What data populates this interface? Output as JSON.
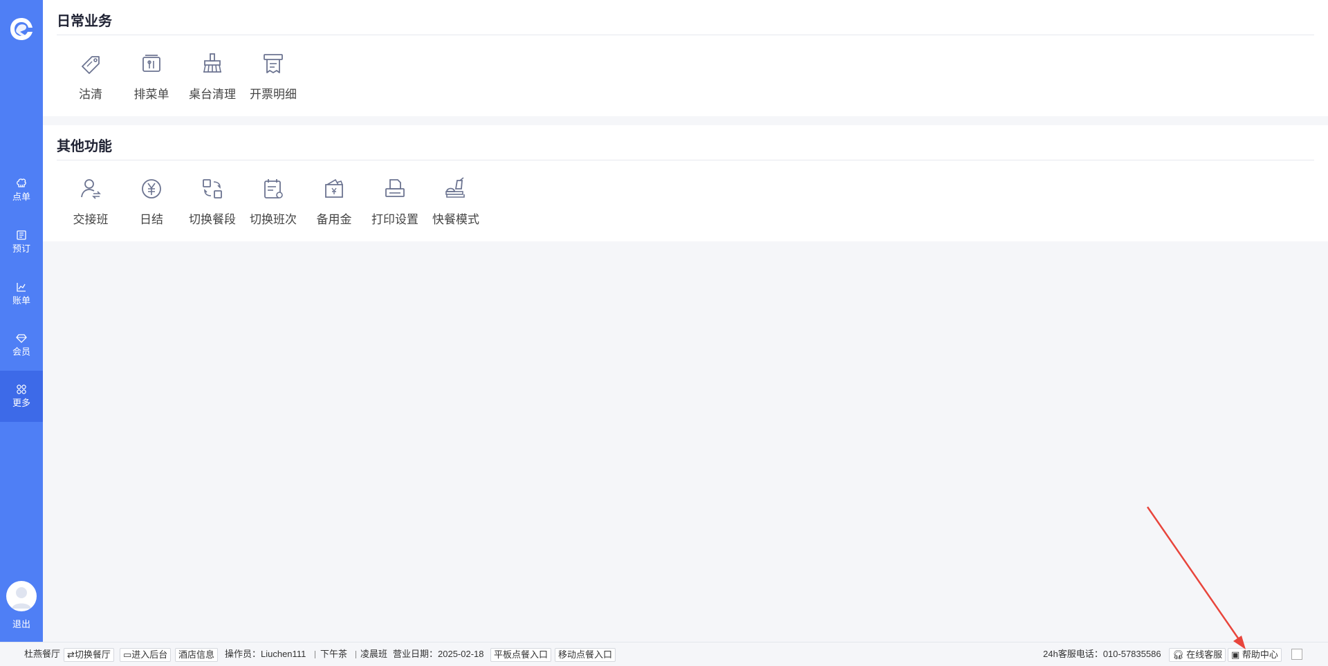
{
  "sidebar": {
    "logo": "brand-logo",
    "items": [
      {
        "label": "点单",
        "icon": "chef-hat-icon"
      },
      {
        "label": "预订",
        "icon": "booking-icon"
      },
      {
        "label": "账单",
        "icon": "chart-icon"
      },
      {
        "label": "会员",
        "icon": "diamond-icon"
      },
      {
        "label": "更多",
        "icon": "grid-icon",
        "active": true
      }
    ],
    "logout": "退出"
  },
  "daily": {
    "title": "日常业务",
    "items": [
      {
        "label": "沽清",
        "icon": "tag-icon"
      },
      {
        "label": "排菜单",
        "icon": "menu-icon"
      },
      {
        "label": "桌台清理",
        "icon": "broom-icon"
      },
      {
        "label": "开票明细",
        "icon": "receipt-icon"
      }
    ]
  },
  "other": {
    "title": "其他功能",
    "items": [
      {
        "label": "交接班",
        "icon": "handover-icon"
      },
      {
        "label": "日结",
        "icon": "yen-icon"
      },
      {
        "label": "切换餐段",
        "icon": "switch-icon"
      },
      {
        "label": "切换班次",
        "icon": "calendar-icon"
      },
      {
        "label": "备用金",
        "icon": "wallet-icon"
      },
      {
        "label": "打印设置",
        "icon": "printer-icon"
      },
      {
        "label": "快餐模式",
        "icon": "fastfood-icon"
      }
    ]
  },
  "footer": {
    "restaurant": "杜燕餐厅",
    "switch_restaurant": "切换餐厅",
    "backend": "进入后台",
    "hotel_info": "酒店信息",
    "operator": "操作员：Liuchen111",
    "meal_period": "下午茶",
    "shift": "凌晨班",
    "business_date": "营业日期：2025-02-18",
    "tablet_entry": "平板点餐入口",
    "mobile_entry": "移动点餐入口",
    "hotline": "24h客服电话：010-57835586",
    "online_service": "在线客服",
    "help_center": "帮助中心"
  },
  "colors": {
    "sidebar": "#4f7ff5",
    "sidebar_active": "#3d6ae8",
    "icon": "#6b7390",
    "arrow": "#e8453c"
  }
}
